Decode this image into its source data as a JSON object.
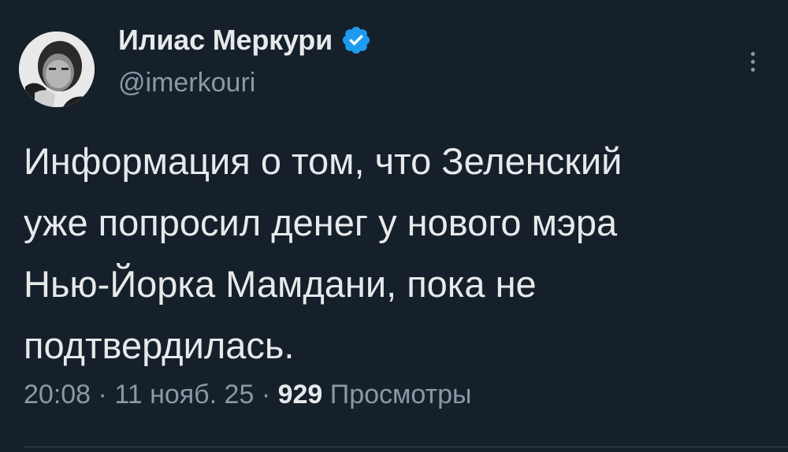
{
  "author": {
    "name": "Илиас Меркури",
    "handle": "@imerkouri",
    "verified": true,
    "avatar": "portrait-photo"
  },
  "tweet": {
    "text": "Информация о том, что Зеленский\nуже попросил денег у нового мэра\nНью-Йорка Мамдани, пока не\nподтвердилась.",
    "time": "20:08",
    "separator_1": "·",
    "date": "11 нояб. 25",
    "separator_2": "·",
    "views_count": "929",
    "views_label": "Просмотры"
  },
  "icons": {
    "verified": "verified-badge-icon",
    "more": "more-options-icon"
  },
  "colors": {
    "background": "#15202b",
    "text_primary": "#e7e9ea",
    "text_secondary": "#8b98a5",
    "verified_blue": "#1d9bf0",
    "divider": "#38444d"
  }
}
